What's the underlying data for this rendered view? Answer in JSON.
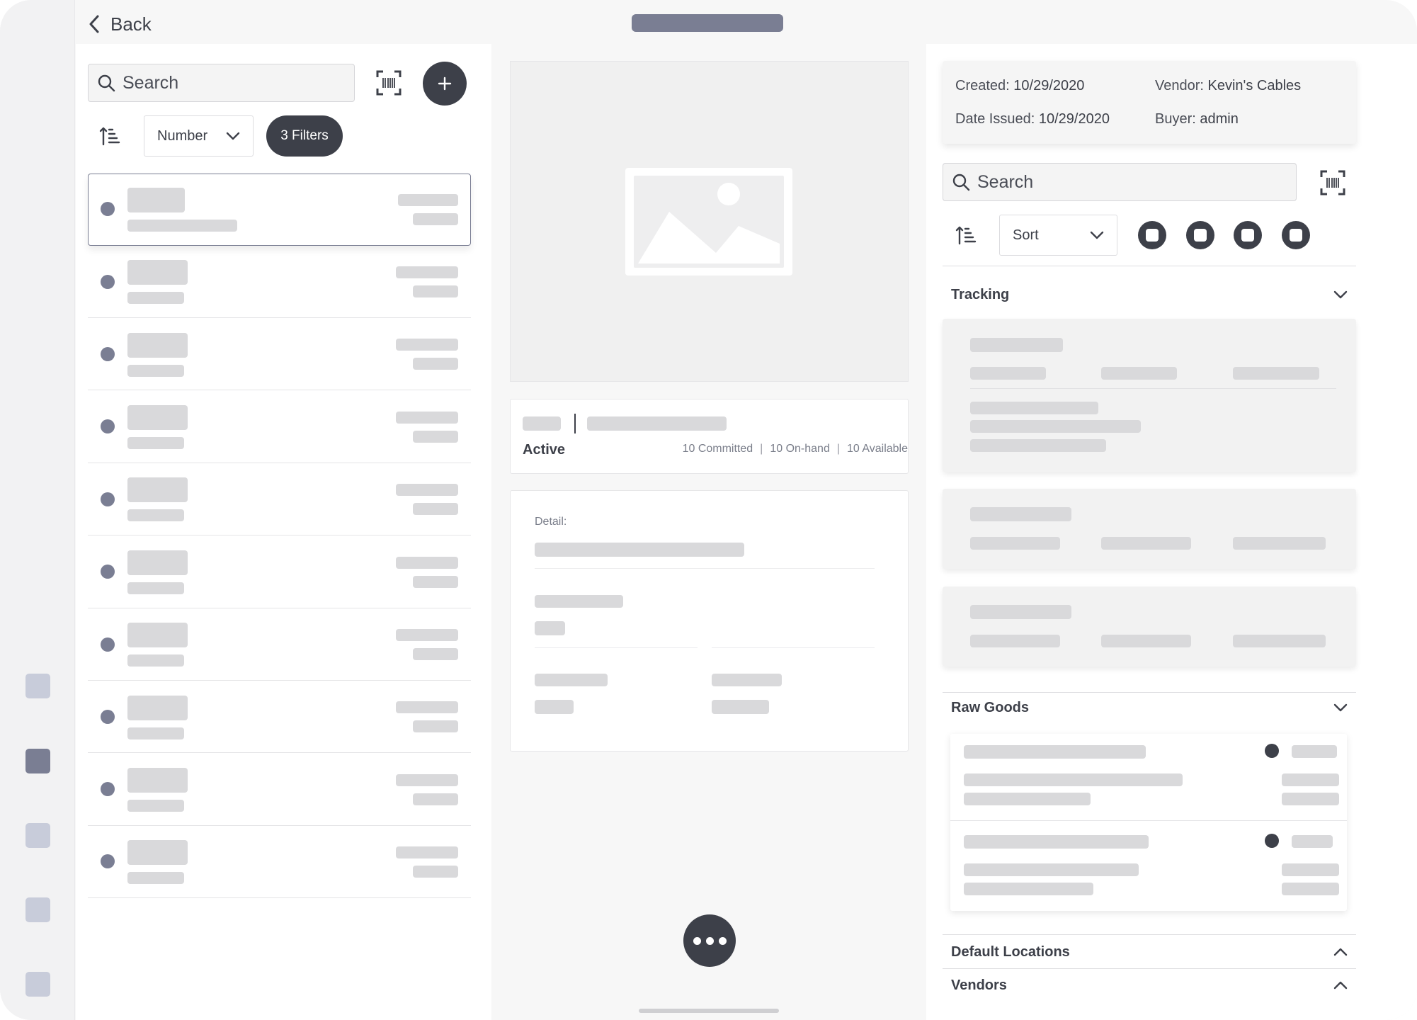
{
  "header": {
    "back_label": "Back"
  },
  "left": {
    "search_placeholder": "Search",
    "sort_field": "Number",
    "filters_label": "3 Filters"
  },
  "middle": {
    "status": "Active",
    "committed": "10 Committed",
    "on_hand": "10 On-hand",
    "available": "10 Available",
    "separator": "|",
    "detail_label": "Detail:"
  },
  "right": {
    "meta": {
      "created_label": "Created:",
      "created_value": "10/29/2020",
      "vendor_label": "Vendor:",
      "vendor_value": "Kevin's Cables",
      "issued_label": "Date Issued:",
      "issued_value": "10/29/2020",
      "buyer_label": "Buyer:",
      "buyer_value": "admin"
    },
    "search_placeholder": "Search",
    "sort_label": "Sort",
    "sections": {
      "tracking": "Tracking",
      "raw_goods": "Raw Goods",
      "default_locations": "Default Locations",
      "vendors": "Vendors"
    }
  },
  "icons": {
    "back": "chevron-left-icon",
    "search": "search-icon",
    "barcode": "barcode-scan-icon",
    "add": "plus-icon",
    "sort_order": "sort-order-icon",
    "dropdown": "chevron-down-icon",
    "collapse": "chevron-up-icon",
    "image": "image-placeholder-icon",
    "more": "more-horizontal-icon"
  },
  "colors": {
    "primary_dark": "#3d4049",
    "accent_muted": "#7a7e93",
    "rail_item": "#c8ccda",
    "skeleton": "#d9d9db"
  }
}
